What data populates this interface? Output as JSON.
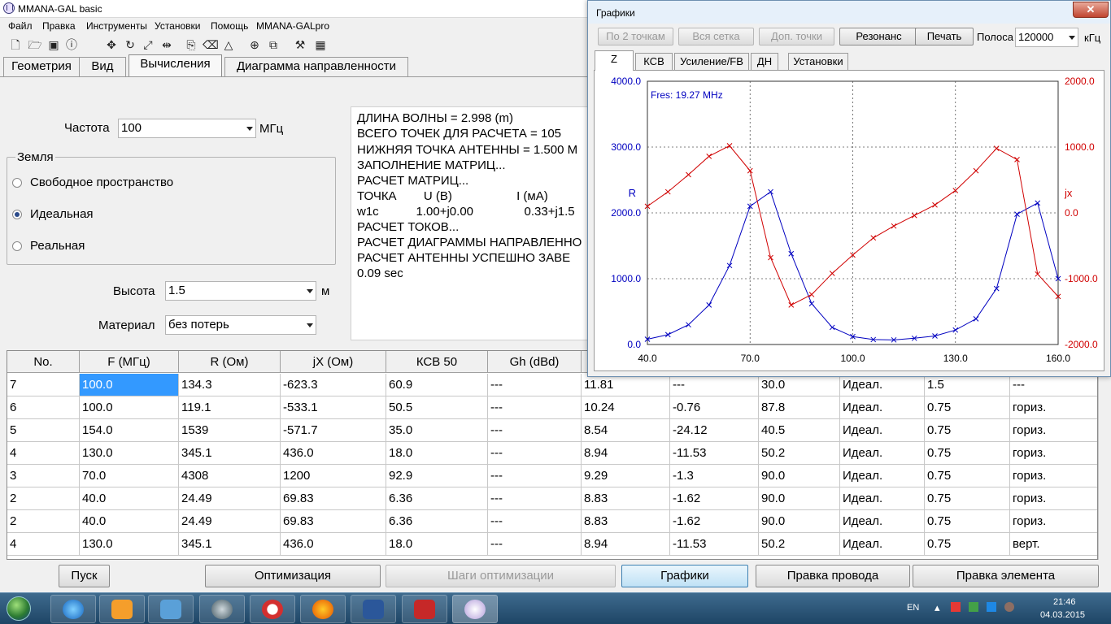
{
  "app": {
    "title": "MMANA-GAL basic"
  },
  "menu": [
    "Файл",
    "Правка",
    "Инструменты",
    "Установки",
    "Помощь",
    "MMANA-GALpro"
  ],
  "toolbar_icons": [
    "new-file-icon",
    "open-folder-icon",
    "save-icon",
    "info-icon",
    "move-icon",
    "rotate-icon",
    "stretch-icon",
    "divide-icon",
    "copy-icon",
    "erase-icon",
    "triangle-icon",
    "target-icon",
    "duplicate-icon",
    "tools-icon",
    "calculator-icon"
  ],
  "tabs": [
    "Геометрия",
    "Вид",
    "Вычисления",
    "Диаграмма направленности"
  ],
  "calc": {
    "freq_label": "Частота",
    "freq_value": "100",
    "freq_unit": "МГц",
    "ground_legend": "Земля",
    "ground_options": [
      "Свободное пространство",
      "Идеальная",
      "Реальная"
    ],
    "ground_selected": 1,
    "height_label": "Высота",
    "height_value": "1.5",
    "height_unit": "м",
    "material_label": "Материал",
    "material_value": "без потерь"
  },
  "log_lines": [
    "ДЛИНА ВОЛНЫ = 2.998 (m)",
    "ВСЕГО ТОЧЕК ДЛЯ РАСЧЕТА = 105",
    "НИЖНЯЯ ТОЧКА АНТЕННЫ = 1.500 M",
    "ЗАПОЛНЕНИЕ МАТРИЦ...",
    "РАСЧЕТ МАТРИЦ...",
    "ТОЧКА        U (В)                   I (мА)",
    "w1c           1.00+j0.00               0.33+j1.5",
    "РАСЧЕТ ТОКОВ...",
    "РАСЧЕТ ДИАГРАММЫ НАПРАВЛЕННО",
    "РАСЧЕТ АНТЕННЫ УСПЕШНО ЗАВЕ",
    "0.09 sec"
  ],
  "table": {
    "headers": [
      "No.",
      "F (МГц)",
      "R (Ом)",
      "jX (Ом)",
      "КСВ 50",
      "Gh (dBd)",
      "",
      "",
      "",
      "",
      "",
      ""
    ],
    "rows": [
      [
        "7",
        "100.0",
        "134.3",
        "-623.3",
        "60.9",
        "---",
        "11.81",
        "---",
        "30.0",
        "Идеал.",
        "1.5",
        "---"
      ],
      [
        "6",
        "100.0",
        "119.1",
        "-533.1",
        "50.5",
        "---",
        "10.24",
        "-0.76",
        "87.8",
        "Идеал.",
        "0.75",
        "гориз."
      ],
      [
        "5",
        "154.0",
        "1539",
        "-571.7",
        "35.0",
        "---",
        "8.54",
        "-24.12",
        "40.5",
        "Идеал.",
        "0.75",
        "гориз."
      ],
      [
        "4",
        "130.0",
        "345.1",
        "436.0",
        "18.0",
        "---",
        "8.94",
        "-11.53",
        "50.2",
        "Идеал.",
        "0.75",
        "гориз."
      ],
      [
        "3",
        "70.0",
        "4308",
        "1200",
        "92.9",
        "---",
        "9.29",
        "-1.3",
        "90.0",
        "Идеал.",
        "0.75",
        "гориз."
      ],
      [
        "2",
        "40.0",
        "24.49",
        "69.83",
        "6.36",
        "---",
        "8.83",
        "-1.62",
        "90.0",
        "Идеал.",
        "0.75",
        "гориз."
      ],
      [
        "2",
        "40.0",
        "24.49",
        "69.83",
        "6.36",
        "---",
        "8.83",
        "-1.62",
        "90.0",
        "Идеал.",
        "0.75",
        "гориз."
      ],
      [
        "4",
        "130.0",
        "345.1",
        "436.0",
        "18.0",
        "---",
        "8.94",
        "-11.53",
        "50.2",
        "Идеал.",
        "0.75",
        "верт."
      ]
    ]
  },
  "bottom_buttons": {
    "run": "Пуск",
    "optimize": "Оптимизация",
    "opt_steps": "Шаги оптимизации",
    "graphs": "Графики",
    "edit_wire": "Правка провода",
    "edit_element": "Правка элемента"
  },
  "graph_window": {
    "title": "Графики",
    "close": "✕",
    "buttons": [
      "По 2 точкам",
      "Вся сетка",
      "Доп. точки",
      "Резонанс",
      "Печать"
    ],
    "band_label": "Полоса",
    "band_value": "120000",
    "band_unit": "кГц",
    "tabs": [
      "Z",
      "КСВ",
      "Усиление/FB",
      "ДН",
      "Установки"
    ],
    "annotation": "Fres: 19.27 MHz",
    "left_axis_label": "R",
    "right_axis_label": "jx"
  },
  "colors": {
    "r_series": "#0000c0",
    "jx_series": "#d00000",
    "selection": "#3399ff"
  },
  "chart_data": {
    "type": "line",
    "xlim": [
      40.0,
      160.0
    ],
    "xticks": [
      "40.0",
      "70.0",
      "100.0",
      "130.0",
      "160.0"
    ],
    "ylim_left": [
      0.0,
      4000.0
    ],
    "yticks_left": [
      "0.0",
      "1000.0",
      "2000.0",
      "3000.0",
      "4000.0"
    ],
    "ylim_right": [
      -2000.0,
      2000.0
    ],
    "yticks_right": [
      "-2000.0",
      "-1000.0",
      "0.0",
      "1000.0",
      "2000.0"
    ],
    "grid": true,
    "series": [
      {
        "name": "R",
        "axis": "left",
        "x": [
          40,
          46,
          52,
          58,
          64,
          70,
          76,
          82,
          88,
          94,
          100,
          106,
          112,
          118,
          124,
          130,
          136,
          142,
          148,
          154,
          160
        ],
        "y": [
          80,
          150,
          300,
          600,
          1200,
          2100,
          2320,
          1380,
          620,
          260,
          120,
          75,
          70,
          95,
          130,
          220,
          390,
          850,
          1980,
          2150,
          1000
        ]
      },
      {
        "name": "jx",
        "axis": "right",
        "x": [
          40,
          46,
          52,
          58,
          64,
          70,
          76,
          82,
          88,
          94,
          100,
          106,
          112,
          118,
          124,
          130,
          136,
          142,
          148,
          154,
          160
        ],
        "y": [
          100,
          320,
          580,
          860,
          1020,
          640,
          -680,
          -1400,
          -1240,
          -920,
          -640,
          -380,
          -200,
          -40,
          120,
          340,
          640,
          980,
          810,
          -930,
          -1270
        ]
      }
    ]
  }
}
